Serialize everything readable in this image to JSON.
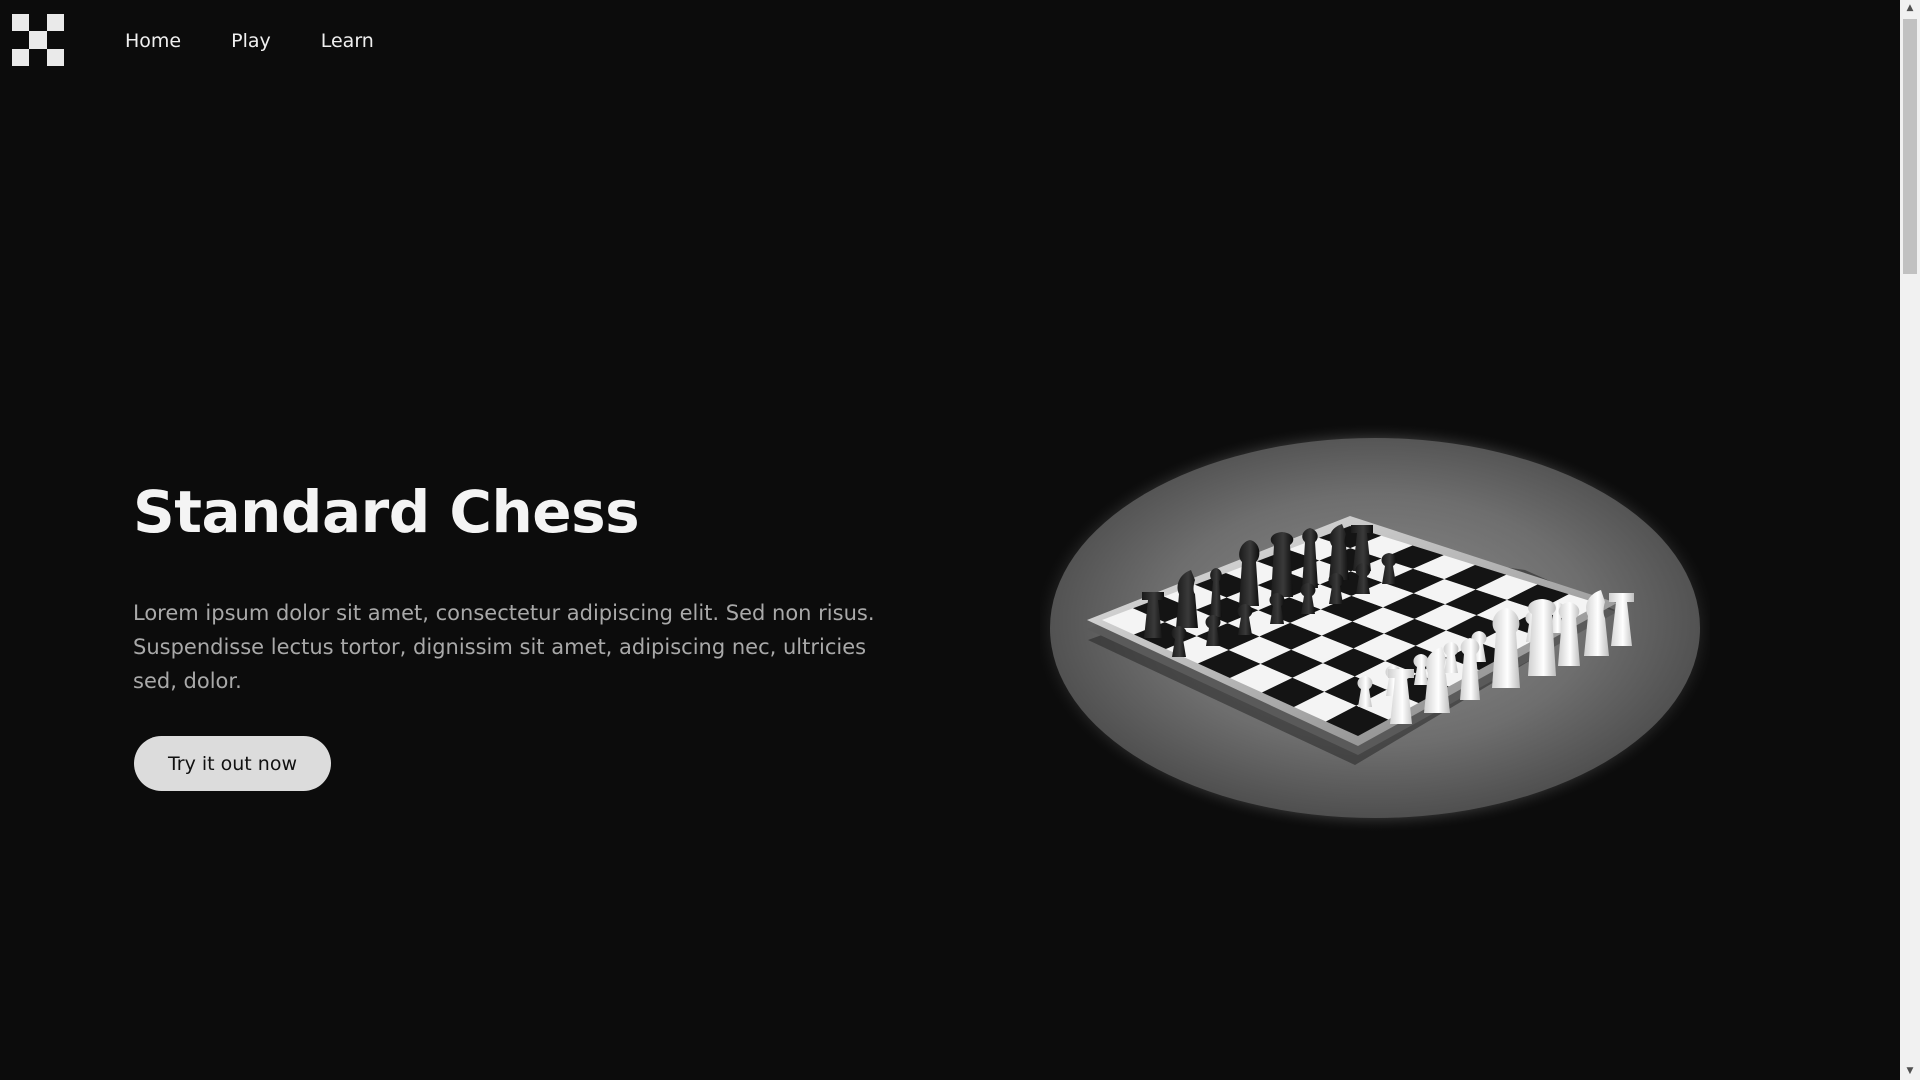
{
  "nav": {
    "logo_icon": "checkerboard-logo-icon",
    "links": [
      {
        "label": "Home"
      },
      {
        "label": "Play"
      },
      {
        "label": "Learn"
      }
    ]
  },
  "hero": {
    "title": "Standard Chess",
    "description": "Lorem ipsum dolor sit amet, consectetur adipiscing elit. Sed non risus. Suspendisse lectus tortor, dignissim sit amet, adipiscing nec, ultricies sed, dolor.",
    "cta_label": "Try it out now",
    "image_icon": "chessboard-illustration"
  },
  "colors": {
    "background": "#0c0c0c",
    "text": "#f4f4f4",
    "muted_text": "#a9a9a9",
    "button_bg": "#dcdcdc",
    "button_text": "#111111"
  },
  "scrollbar": {
    "up_icon": "scroll-up-arrow-icon",
    "down_icon": "scroll-down-arrow-icon"
  }
}
